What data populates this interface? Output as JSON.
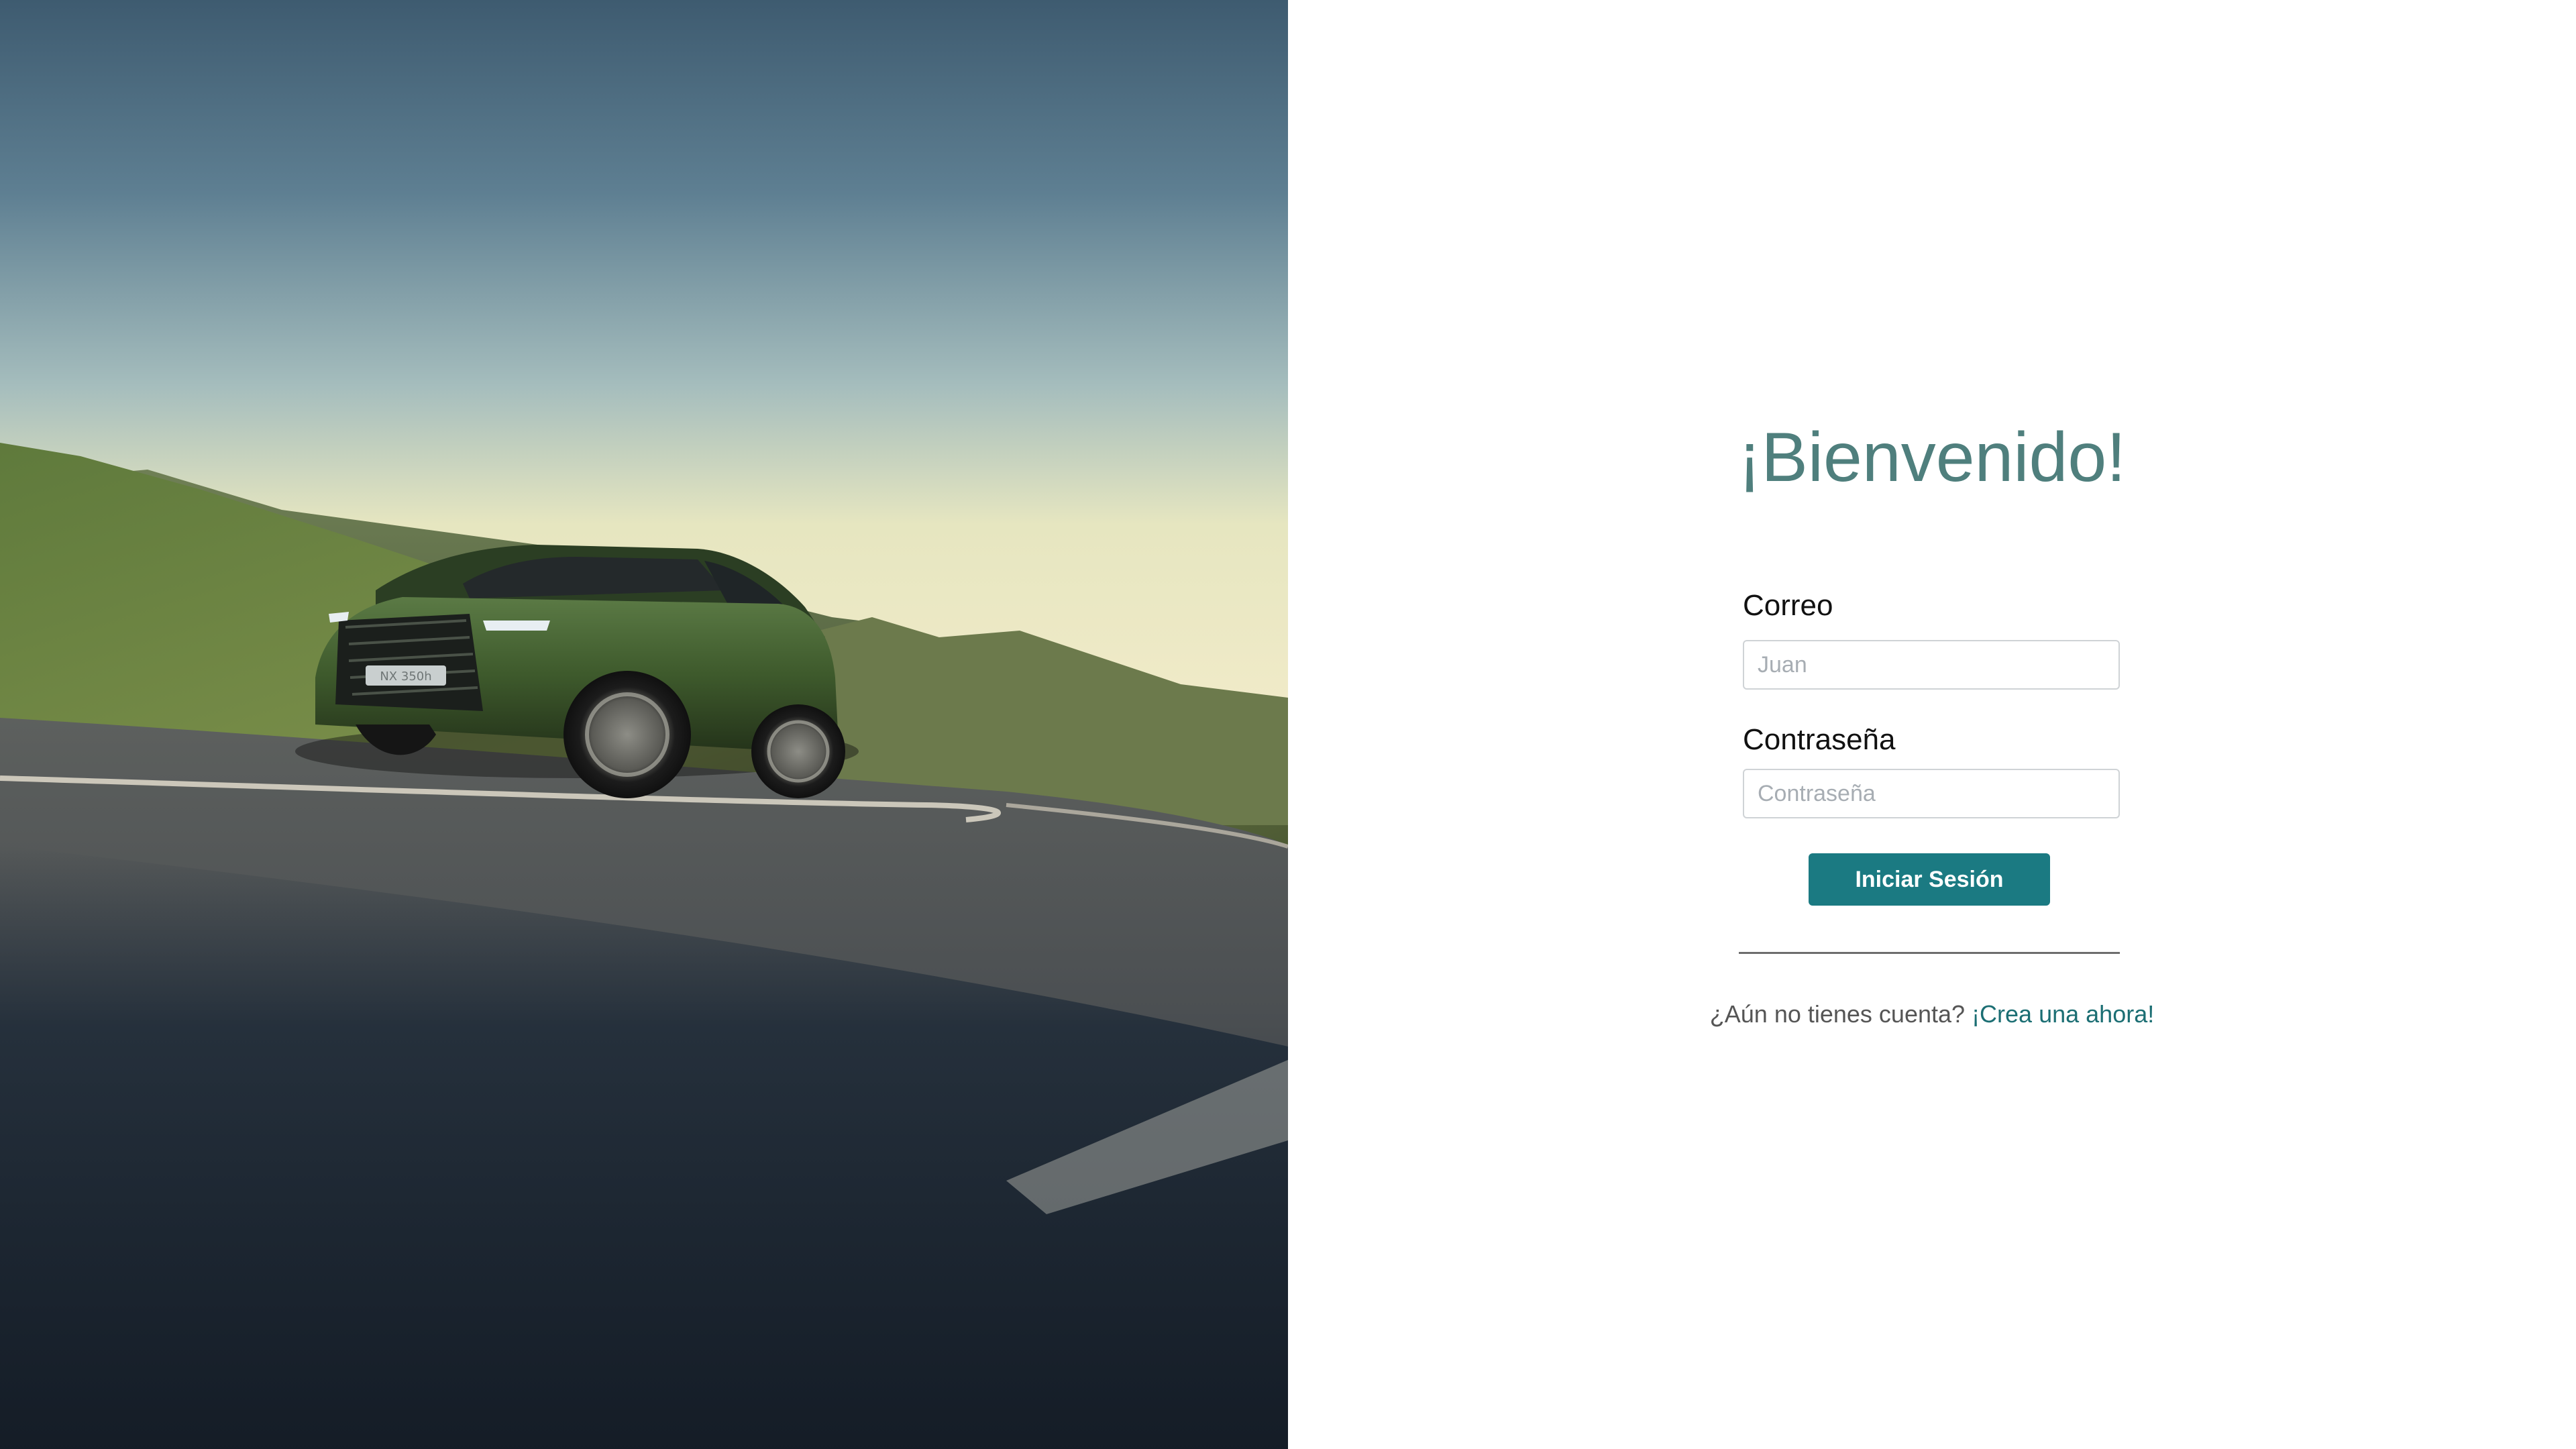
{
  "hero": {
    "image": "green-suv-driving-on-mountain-road-photo",
    "license_plate": "NX 350h"
  },
  "login": {
    "title": "¡Bienvenido!",
    "email_label": "Correo",
    "email_placeholder": "Juan",
    "email_value": "",
    "password_label": "Contraseña",
    "password_placeholder": "Contraseña",
    "password_value": "",
    "submit_label": "Iniciar Sesión",
    "signup_prompt": "¿Aún no tienes cuenta?",
    "signup_link": "¡Crea una ahora!"
  },
  "colors": {
    "title": "#4f7f7d",
    "button": "#1b7a82",
    "link": "#1b6e73",
    "car_body": "#3e5a2c"
  }
}
